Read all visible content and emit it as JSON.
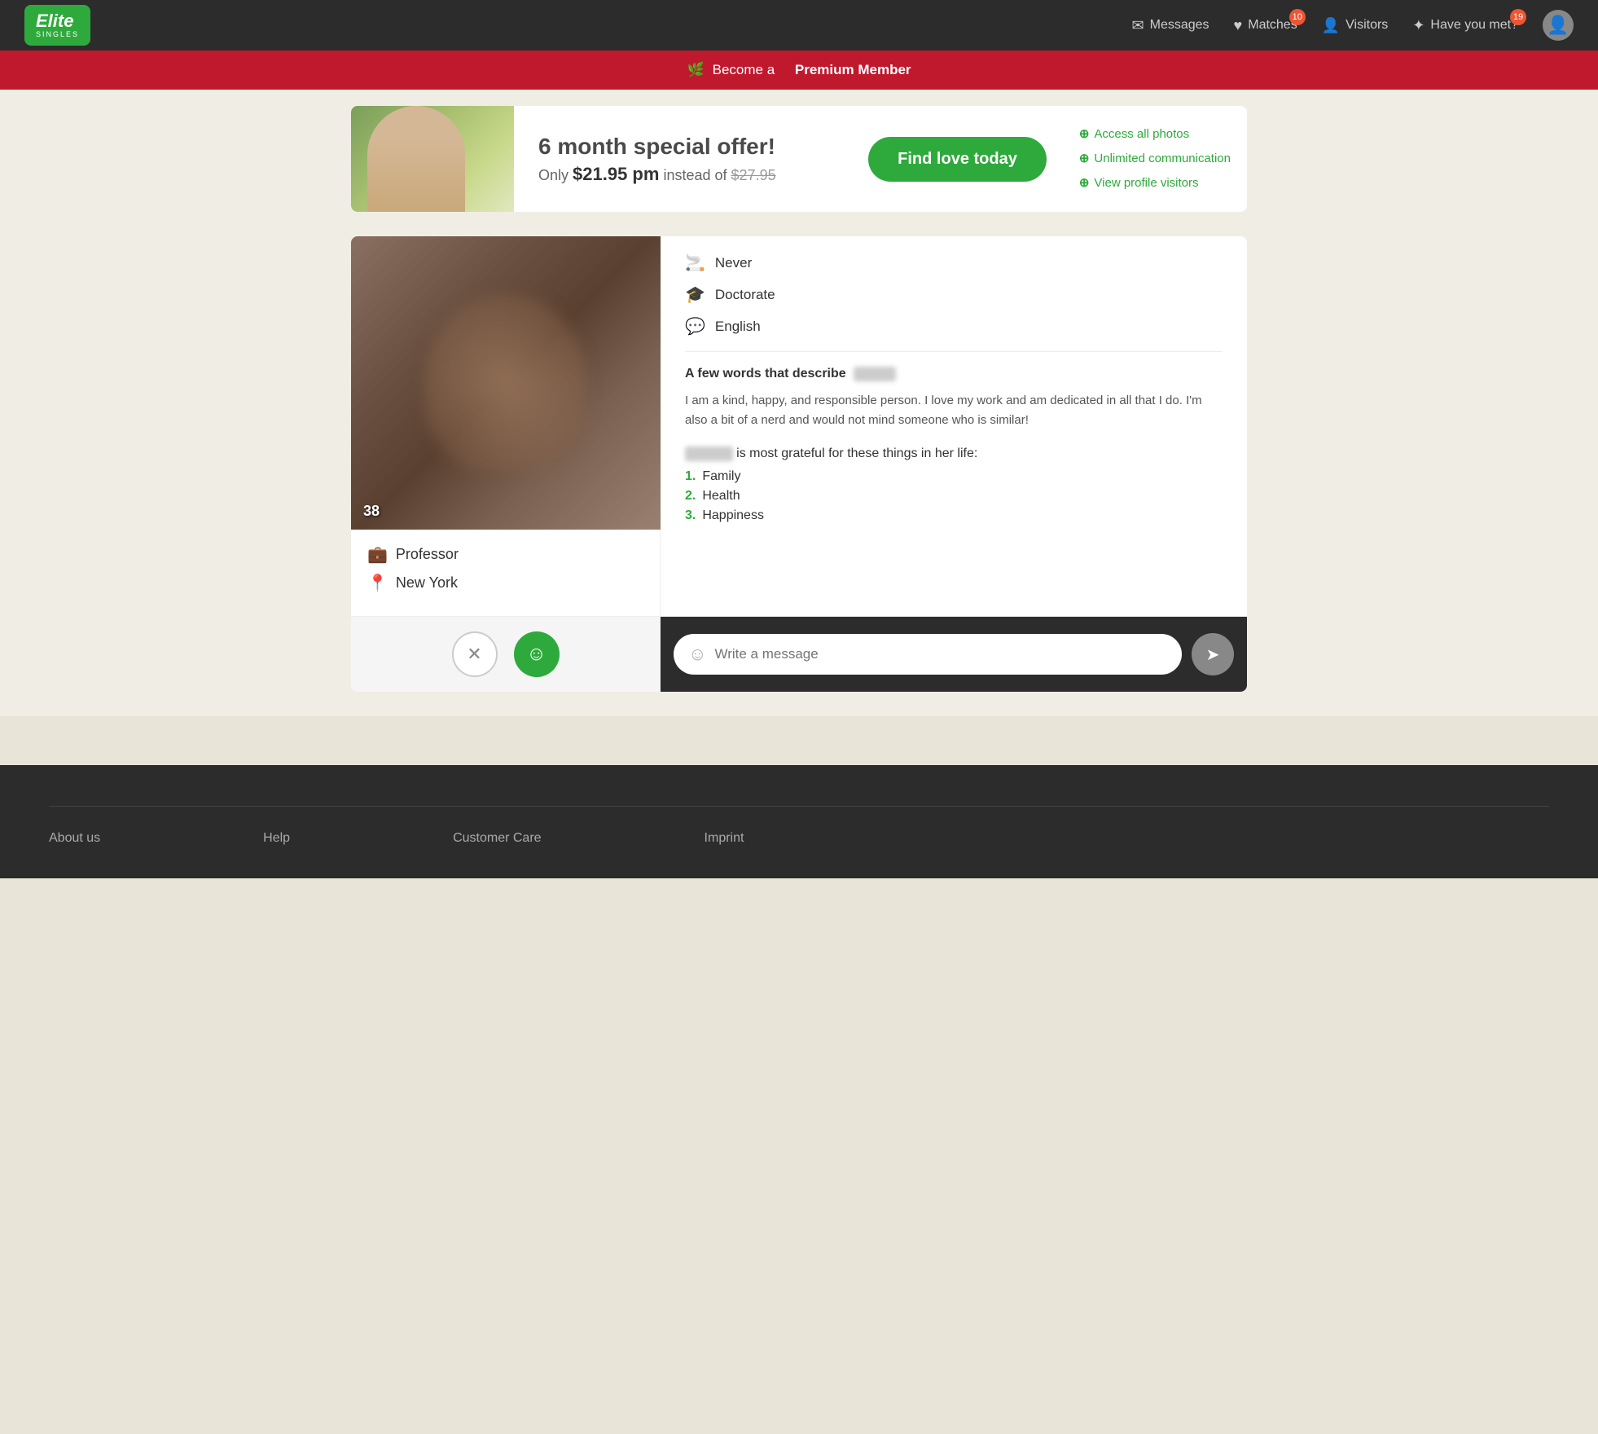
{
  "header": {
    "logo_text": "Elite",
    "logo_sub": "SINGLES",
    "nav": {
      "messages_label": "Messages",
      "matches_label": "Matches",
      "matches_badge": "10",
      "visitors_label": "Visitors",
      "haveyoumet_label": "Have you met?",
      "haveyoumet_badge": "19"
    }
  },
  "premium_banner": {
    "prefix": "Become a",
    "bold": "Premium Member",
    "icon": "♥"
  },
  "offer": {
    "title": "6 month special offer!",
    "price_label": "Only",
    "price": "$21.95 pm",
    "instead": "instead of",
    "old_price": "$27.95",
    "cta": "Find love today",
    "features": [
      "Access all photos",
      "Unlimited communication",
      "View profile visitors"
    ]
  },
  "profile": {
    "age": "38",
    "job": "Professor",
    "location": "New York",
    "attributes": [
      {
        "icon": "smoking",
        "label": "Never"
      },
      {
        "icon": "education",
        "label": "Doctorate"
      },
      {
        "icon": "language",
        "label": "English"
      }
    ],
    "describe_title": "A few words that describe",
    "describe_body": "I am a kind, happy, and responsible person. I love my work and am dedicated in all that I do. I'm also a bit of a nerd and would not mind someone who is similar!",
    "grateful_title": "is most grateful for these things in her life:",
    "grateful_items": [
      "Family",
      "Health",
      "Happiness"
    ],
    "message_placeholder": "Write a message"
  },
  "footer": {
    "links": [
      "About us",
      "Help",
      "Customer Care",
      "Imprint"
    ]
  }
}
